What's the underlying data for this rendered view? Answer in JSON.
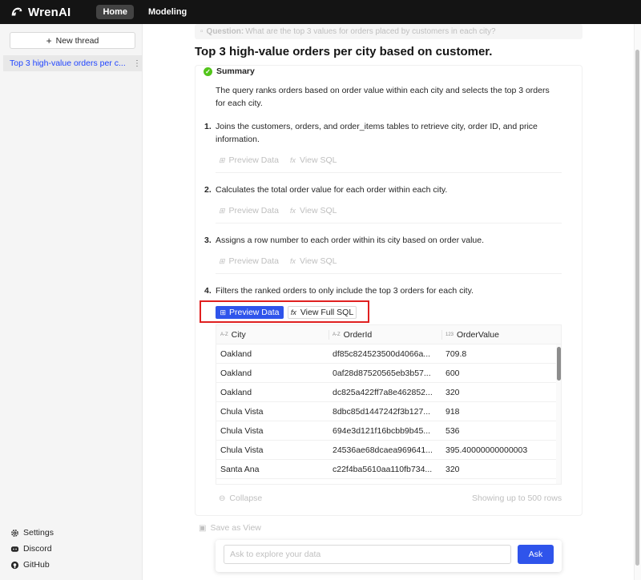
{
  "app": {
    "name": "WrenAI"
  },
  "nav": {
    "home": "Home",
    "modeling": "Modeling"
  },
  "sidebar": {
    "new_thread": "New thread",
    "threads": [
      {
        "label": "Top 3 high-value orders per c..."
      }
    ],
    "links": [
      {
        "label": "Settings",
        "icon": "gear-icon"
      },
      {
        "label": "Discord",
        "icon": "discord-icon"
      },
      {
        "label": "GitHub",
        "icon": "github-icon"
      }
    ]
  },
  "question": {
    "label": "Question:",
    "text": "What are the top 3 values for orders placed by customers in each city?"
  },
  "title": "Top 3 high-value orders per city based on customer.",
  "summary": {
    "heading": "Summary",
    "text": "The query ranks orders based on order value within each city and selects the top 3 orders for each city."
  },
  "steps": [
    {
      "num": "1.",
      "text": "Joins the customers, orders, and order_items tables to retrieve city, order ID, and price information."
    },
    {
      "num": "2.",
      "text": "Calculates the total order value for each order within each city."
    },
    {
      "num": "3.",
      "text": "Assigns a row number to each order within its city based on order value."
    },
    {
      "num": "4.",
      "text": "Filters the ranked orders to only include the top 3 orders for each city."
    }
  ],
  "actions": {
    "preview": "Preview Data",
    "view_sql": "View SQL",
    "view_full_sql": "View Full SQL"
  },
  "table": {
    "columns": [
      {
        "type": "A-Z",
        "name": "City"
      },
      {
        "type": "A-Z",
        "name": "OrderId"
      },
      {
        "type": "123",
        "name": "OrderValue"
      }
    ],
    "rows": [
      [
        "Oakland",
        "df85c824523500d4066a...",
        "709.8"
      ],
      [
        "Oakland",
        "0af28d87520565eb3b57...",
        "600"
      ],
      [
        "Oakland",
        "dc825a422ff7a8e462852...",
        "320"
      ],
      [
        "Chula Vista",
        "8dbc85d1447242f3b127...",
        "918"
      ],
      [
        "Chula Vista",
        "694e3d121f16bcbb9b45...",
        "536"
      ],
      [
        "Chula Vista",
        "24536ae68dcaea969641...",
        "395.40000000000003"
      ],
      [
        "Santa Ana",
        "c22f4ba5610aa110fb734...",
        "320"
      ]
    ]
  },
  "collapse": "Collapse",
  "showing": "Showing up to 500 rows",
  "save_view": "Save as View",
  "ask": {
    "placeholder": "Ask to explore your data",
    "button": "Ask"
  },
  "colors": {
    "accent": "#2f54eb",
    "link": "#1f44ff",
    "success": "#52c41a",
    "highlight": "#e02020",
    "topbar": "#141414"
  }
}
